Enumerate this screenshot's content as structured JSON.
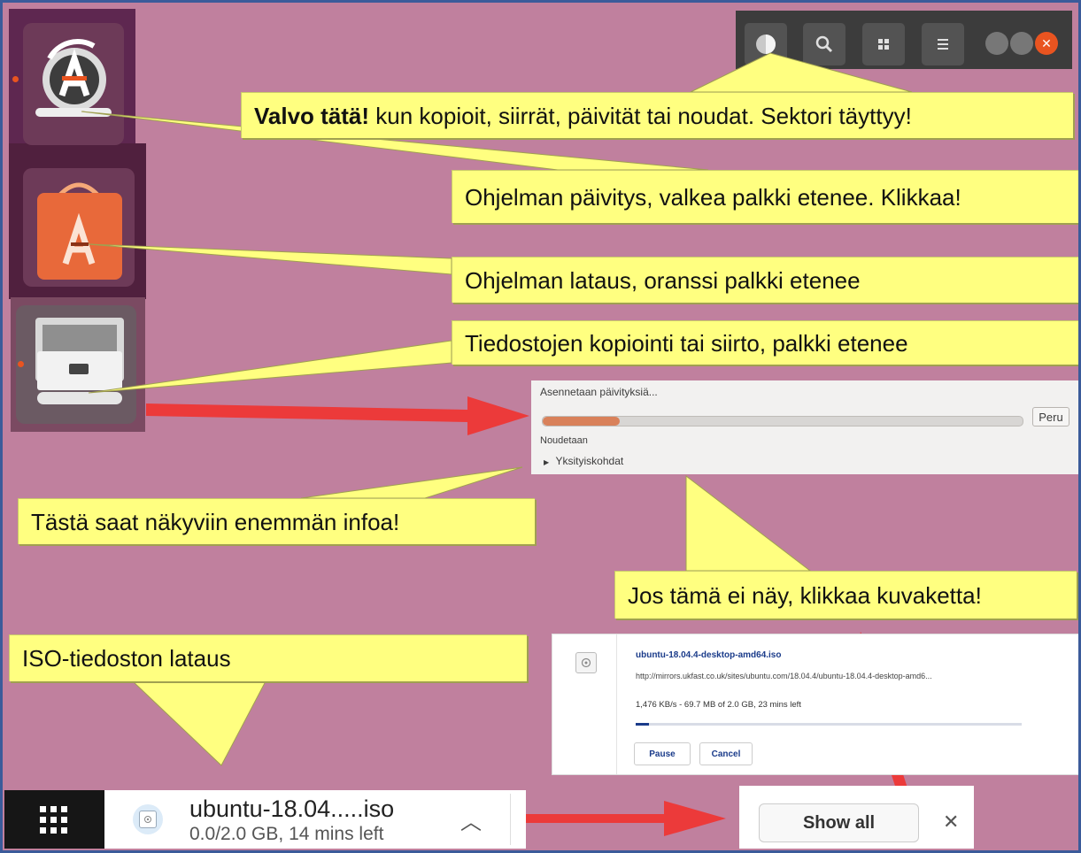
{
  "colors": {
    "background": "#c0809e",
    "callout": "#ffff80",
    "arrow": "#ec3a3a",
    "dock": "#5e2750",
    "progress_orange": "#d9815a"
  },
  "callouts": {
    "sector_bold": "Valvo tätä!",
    "sector_rest": " kun kopioit, siirrät, päivität tai noudat. Sektori täyttyy!",
    "software_update": "Ohjelman päivitys, valkea palkki etenee. Klikkaa!",
    "software_download": "Ohjelman lataus, oranssi palkki etenee",
    "file_copy": "Tiedostojen kopiointi tai siirto, palkki etenee",
    "more_info": "Tästä saat näkyviin enemmän infoa!",
    "click_icon": "Jos tämä ei näy, klikkaa kuvaketta!",
    "iso_download": "ISO-tiedoston lataus"
  },
  "topbar": {
    "icons": [
      "progress-pie-icon",
      "search-icon",
      "apps-grid-icon",
      "hamburger-menu-icon",
      "window-controls"
    ]
  },
  "update_dialog": {
    "title": "Asennetaan päivityksiä...",
    "progress": 0.16,
    "cancel_label": "Peru",
    "status": "Noudetaan",
    "details_label": "Yksityiskohdat"
  },
  "download_card": {
    "filename": "ubuntu-18.04.4-desktop-amd64.iso",
    "url": "http://mirrors.ukfast.co.uk/sites/ubuntu.com/18.04.4/ubuntu-18.04.4-desktop-amd6...",
    "status": "1,476 KB/s - 69.7 MB of 2.0 GB, 23 mins left",
    "progress": 0.035,
    "pause_label": "Pause",
    "cancel_label": "Cancel"
  },
  "download_shelf": {
    "filename": "ubuntu-18.04.....iso",
    "status": "0.0/2.0 GB, 14 mins left",
    "show_all_label": "Show all",
    "close_symbol": "✕"
  }
}
